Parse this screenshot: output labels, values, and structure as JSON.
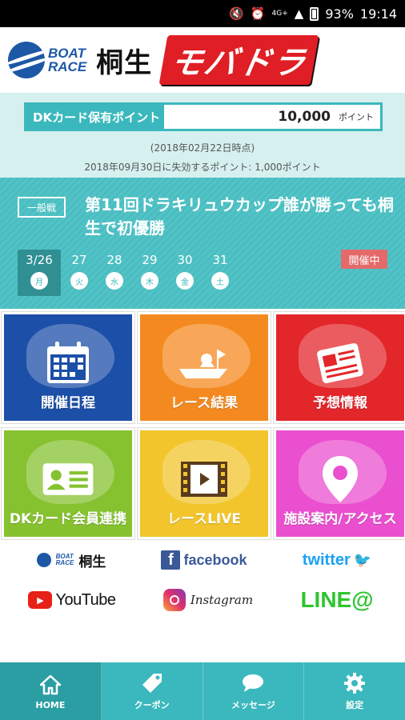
{
  "status_bar": {
    "battery": "93%",
    "time": "19:14",
    "network": "4G+",
    "icons": [
      "mute-icon",
      "alarm-icon",
      "volte-icon",
      "signal-icon",
      "battery-icon"
    ]
  },
  "header": {
    "boat_race_line1": "BOAT",
    "boat_race_line2": "RACE",
    "venue": "桐生",
    "app_name": "モバドラ"
  },
  "points": {
    "label": "DKカード保有ポイント",
    "value": "10,000",
    "unit": "ポイント",
    "as_of": "(2018年02月22日時点)",
    "expiring": "2018年09月30日に失効するポイント: 1,000ポイント"
  },
  "news": {
    "tag": "一般戦",
    "title": "第11回ドラキリュウカップ誰が勝っても桐生で初優勝",
    "status_badge": "開催中",
    "days": [
      {
        "date": "3/26",
        "weekday": "月",
        "active": true
      },
      {
        "date": "27",
        "weekday": "火",
        "active": false
      },
      {
        "date": "28",
        "weekday": "水",
        "active": false
      },
      {
        "date": "29",
        "weekday": "木",
        "active": false
      },
      {
        "date": "30",
        "weekday": "金",
        "active": false
      },
      {
        "date": "31",
        "weekday": "土",
        "active": false
      }
    ]
  },
  "tiles": [
    {
      "label": "開催日程",
      "icon": "calendar-icon",
      "color": "#1c4fa8"
    },
    {
      "label": "レース結果",
      "icon": "boat-icon",
      "color": "#f48a1f"
    },
    {
      "label": "予想情報",
      "icon": "newspaper-icon",
      "color": "#e3262a"
    },
    {
      "label": "DKカード会員連携",
      "icon": "member-card-icon",
      "color": "#86c230"
    },
    {
      "label": "レースLIVE",
      "icon": "video-play-icon",
      "color": "#f2c52c"
    },
    {
      "label": "施設案内/アクセス",
      "icon": "map-pin-icon",
      "color": "#ea4fcf"
    }
  ],
  "social": {
    "boatrace_line1": "BOAT",
    "boatrace_line2": "RACE",
    "boatrace_venue": "桐生",
    "facebook": "facebook",
    "facebook_f": "f",
    "twitter": "twitter",
    "youtube": "YouTube",
    "instagram": "Instagram",
    "line": "LINE@"
  },
  "bottom_nav": [
    {
      "label": "HOME",
      "icon": "home-icon",
      "active": true
    },
    {
      "label": "クーポン",
      "icon": "coupon-tag-icon",
      "active": false
    },
    {
      "label": "メッセージ",
      "icon": "message-bubble-icon",
      "active": false
    },
    {
      "label": "設定",
      "icon": "gear-icon",
      "active": false
    }
  ],
  "colors": {
    "accent": "#3bb8bd",
    "brand_blue": "#1d58a6",
    "brand_red": "#e01e25"
  }
}
